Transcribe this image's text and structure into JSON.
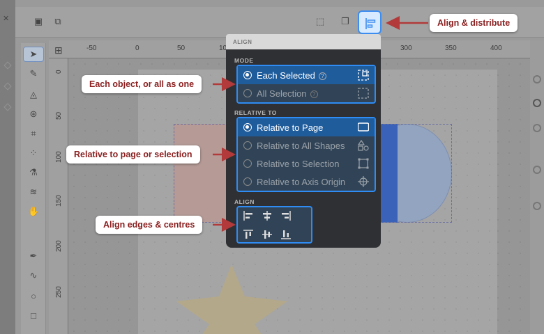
{
  "popover": {
    "header": "ALIGN",
    "mode": {
      "section": "MODE",
      "options": [
        {
          "label": "Each Selected",
          "selected": true
        },
        {
          "label": "All Selection",
          "selected": false
        }
      ]
    },
    "relative": {
      "section": "RELATIVE TO",
      "options": [
        {
          "label": "Relative to Page",
          "selected": true
        },
        {
          "label": "Relative to All Shapes",
          "selected": false
        },
        {
          "label": "Relative to Selection",
          "selected": false
        },
        {
          "label": "Relative to Axis Origin",
          "selected": false
        }
      ]
    },
    "align": {
      "section": "ALIGN",
      "buttons": [
        "align-left-icon",
        "align-center-h-icon",
        "align-right-icon",
        "align-top-icon",
        "align-middle-v-icon",
        "align-bottom-icon"
      ]
    }
  },
  "callouts": {
    "toolbar": "Align & distribute",
    "mode": "Each object, or all as one",
    "relative": "Relative to page or selection",
    "align": "Align edges & centres"
  },
  "ruler": {
    "top": [
      "-50",
      "0",
      "50",
      "100",
      "300",
      "350",
      "400"
    ],
    "left": [
      "0",
      "50",
      "100",
      "150",
      "200",
      "250"
    ]
  },
  "colors": {
    "accent": "#2f8cf5",
    "callout_text": "#8b2020",
    "arrow": "#b23a3a",
    "panel_bg": "#2f3033"
  }
}
